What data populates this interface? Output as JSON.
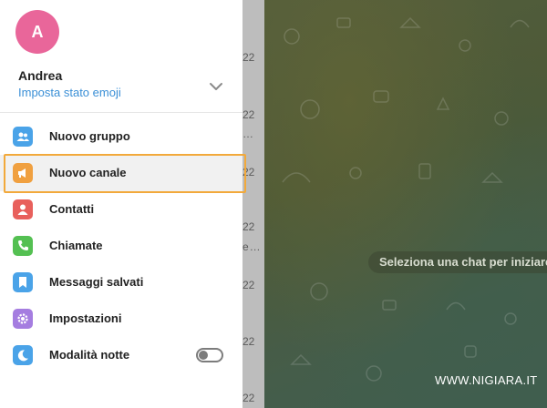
{
  "user": {
    "initial": "A",
    "name": "Andrea",
    "status_link": "Imposta stato emoji"
  },
  "menu": {
    "items": [
      {
        "label": "Nuovo gruppo",
        "icon": "group-icon",
        "color": "#4aa3e8"
      },
      {
        "label": "Nuovo canale",
        "icon": "megaphone-icon",
        "color": "#f0a040"
      },
      {
        "label": "Contatti",
        "icon": "contact-icon",
        "color": "#e8605c"
      },
      {
        "label": "Chiamate",
        "icon": "phone-icon",
        "color": "#54c052"
      },
      {
        "label": "Messaggi salvati",
        "icon": "bookmark-icon",
        "color": "#4aa3e8"
      },
      {
        "label": "Impostazioni",
        "icon": "gear-icon",
        "color": "#a57de0"
      },
      {
        "label": "Modalità notte",
        "icon": "moon-icon",
        "color": "#4aa3e8"
      }
    ],
    "active_index": 1,
    "night_mode_on": false
  },
  "chat_list": {
    "times": [
      "22",
      "22",
      "22",
      "22",
      "22",
      "22",
      "22"
    ]
  },
  "chat_area": {
    "empty_prompt": "Seleziona una chat per iniziare",
    "watermark": "WWW.NIGIARA.IT"
  },
  "colors": {
    "accent": "#3a8fd6",
    "highlight_border": "#f2a93b",
    "avatar": "#e9669a"
  }
}
